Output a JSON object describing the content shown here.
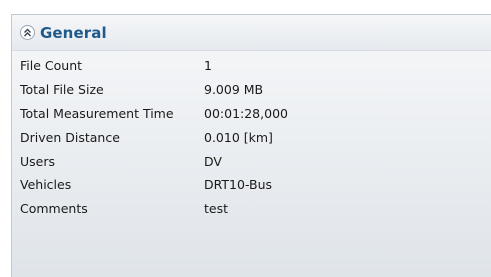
{
  "panel": {
    "title": "General",
    "collapse_icon": "chevron-double-up-icon",
    "title_color": "#1f5a8a",
    "rows": [
      {
        "label": "File Count",
        "value": "1"
      },
      {
        "label": "Total File Size",
        "value": "9.009 MB"
      },
      {
        "label": "Total Measurement Time",
        "value": "00:01:28,000"
      },
      {
        "label": "Driven Distance",
        "value": "0.010 [km]"
      },
      {
        "label": "Users",
        "value": "DV"
      },
      {
        "label": "Vehicles",
        "value": "DRT10-Bus"
      },
      {
        "label": "Comments",
        "value": "test"
      }
    ]
  }
}
